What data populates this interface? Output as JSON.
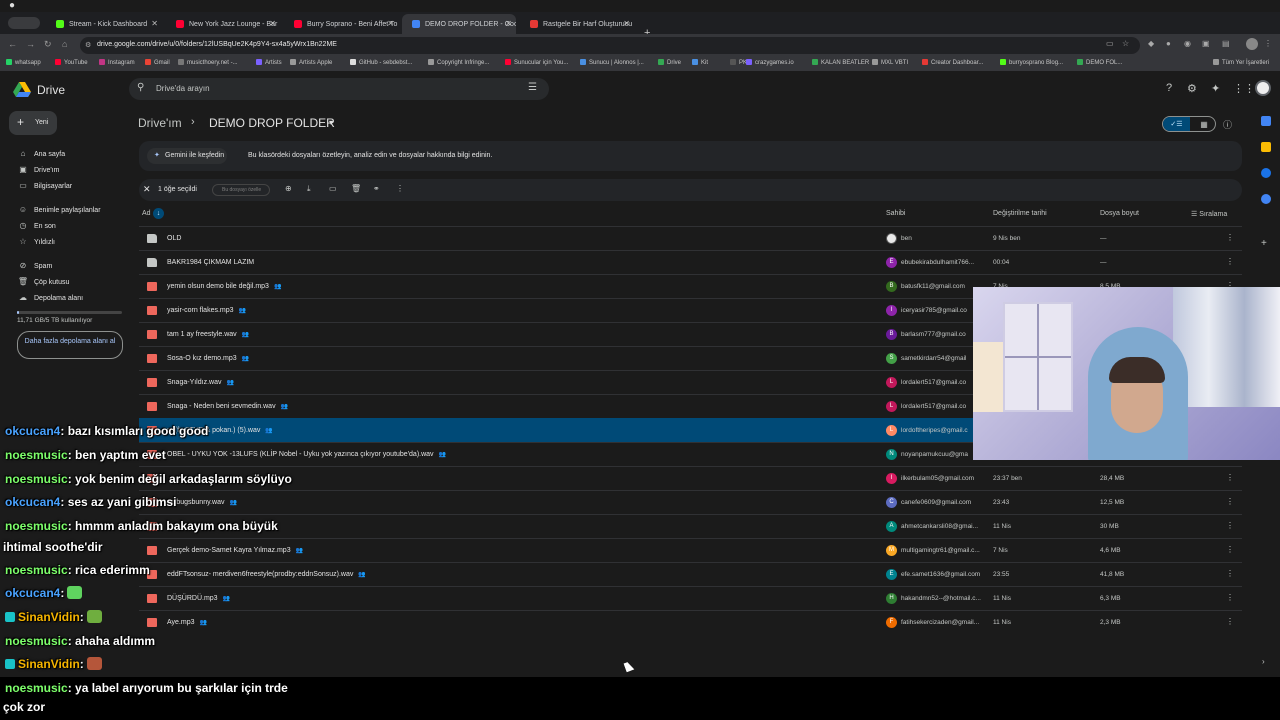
{
  "browser": {
    "tabs": [
      {
        "title": "Stream - Kick Dashboard",
        "color": "#53fc18"
      },
      {
        "title": "New York Jazz Lounge - Bar",
        "color": "#ff0033"
      },
      {
        "title": "Burry Soprano - Beni Affet To",
        "color": "#ff0033"
      },
      {
        "title": "DEMO DROP FOLDER - Goog",
        "color": "#4285f4"
      },
      {
        "title": "Rastgele Bir Harf Oluşturucu",
        "color": "#e53935"
      }
    ],
    "url": "drive.google.com/drive/u/0/folders/12lUSBqUe2K4p9Y4-sx4a5yWrx1Bn22ME",
    "bookmarks": [
      {
        "label": "whatsapp",
        "color": "#25d366"
      },
      {
        "label": "YouTube",
        "color": "#ff0033"
      },
      {
        "label": "Instagram",
        "color": "#c13584"
      },
      {
        "label": "Gmail",
        "color": "#ea4335"
      },
      {
        "label": "musicthoery.net -...",
        "color": "#777777"
      },
      {
        "label": "Artists",
        "color": "#7b61ff"
      },
      {
        "label": "Artists Apple",
        "color": "#999999"
      },
      {
        "label": "GitHub - sebdebst...",
        "color": "#dddddd"
      },
      {
        "label": "Copyright Infringe...",
        "color": "#999999"
      },
      {
        "label": "Sunucular için You...",
        "color": "#ff0033"
      },
      {
        "label": "Sunucu | Alonnos |...",
        "color": "#4a90e2"
      },
      {
        "label": "Drive",
        "color": "#34a853"
      },
      {
        "label": "Kit",
        "color": "#4a90e2"
      },
      {
        "label": "PK",
        "color": "#555555"
      },
      {
        "label": "crazygames.io",
        "color": "#7b61ff"
      },
      {
        "label": "KALAN BEATLER",
        "color": "#34a853"
      },
      {
        "label": "MXL VBTI",
        "color": "#999999"
      },
      {
        "label": "Creator Dashboar...",
        "color": "#e53935"
      },
      {
        "label": "burryosprano Blog...",
        "color": "#53fc18"
      },
      {
        "label": "DEMO FOL...",
        "color": "#34a853"
      },
      {
        "label": "Tüm Yer İşaretleri",
        "color": "#999999"
      }
    ]
  },
  "drive": {
    "app_name": "Drive",
    "search_placeholder": "Drive'da arayın",
    "new_label": "Yeni",
    "nav": [
      {
        "label": "Ana sayfa",
        "icon": "home-icon",
        "glyph": "⌂"
      },
      {
        "label": "Drive'ım",
        "icon": "my-drive-icon",
        "glyph": "▣"
      },
      {
        "label": "Bilgisayarlar",
        "icon": "computer-icon",
        "glyph": "▭"
      },
      {
        "label": "Benimle paylaşılanlar",
        "icon": "shared-icon",
        "glyph": "☺"
      },
      {
        "label": "En son",
        "icon": "clock-icon",
        "glyph": "◷"
      },
      {
        "label": "Yıldızlı",
        "icon": "star-icon",
        "glyph": "☆"
      },
      {
        "label": "Spam",
        "icon": "spam-icon",
        "glyph": "⊘"
      },
      {
        "label": "Çöp kutusu",
        "icon": "trash-icon",
        "glyph": "🗑"
      },
      {
        "label": "Depolama alanı",
        "icon": "cloud-icon",
        "glyph": "☁"
      }
    ],
    "storage_text": "11,71 GB/5 TB kullanılıyor",
    "storage_fraction": 0.0023,
    "more_storage": "Daha fazla depolama alanı al",
    "breadcrumb_root": "Drive'ım",
    "breadcrumb_current": "DEMO DROP FOLDER",
    "gemini_chip": "Gemini ile keşfedin",
    "gemini_text": "Bu klasördeki dosyaları özetleyin, analiz edin ve dosyalar hakkında bilgi edinin.",
    "selection_count": "1 öğe seçildi",
    "selection_share": "Bu dosyayı özelle",
    "columns": {
      "name": "Ad",
      "owner": "Sahibi",
      "modified": "Değiştirilme tarihi",
      "size": "Dosya boyut",
      "sort": "Sıralama"
    },
    "files": [
      {
        "name": "OLD",
        "type": "folder",
        "shared": false,
        "owner": "ben",
        "avatar": "",
        "avatar_color": "#e8e8e8",
        "modified": "9 Nis ben",
        "size": "—"
      },
      {
        "name": "BAKR1984 ÇIKMAM LAZIM",
        "type": "folder",
        "shared": false,
        "owner": "ebubekirabdulhamit766...",
        "avatar": "E",
        "avatar_color": "#8e24aa",
        "modified": "00:04",
        "size": "—"
      },
      {
        "name": "yemin olsun demo bile değil.mp3",
        "type": "audio",
        "shared": true,
        "owner": "batusfk11@gmail.com",
        "avatar": "B",
        "avatar_color": "#33691e",
        "modified": "7 Nis",
        "size": "8,5 MB"
      },
      {
        "name": "yasir-corn flakes.mp3",
        "type": "audio",
        "shared": true,
        "owner": "iceryasir785@gmail.co",
        "avatar": "I",
        "avatar_color": "#8e24aa",
        "modified": "",
        "size": ""
      },
      {
        "name": "tam 1 ay freestyle.wav",
        "type": "audio",
        "shared": true,
        "owner": "barlasm777@gmail.co",
        "avatar": "B",
        "avatar_color": "#6a1b9a",
        "modified": "",
        "size": ""
      },
      {
        "name": "Sosa-O kız demo.mp3",
        "type": "audio",
        "shared": true,
        "owner": "sametkirdarr54@gmail",
        "avatar": "S",
        "avatar_color": "#43a047",
        "modified": "",
        "size": ""
      },
      {
        "name": "Snaga-Yıldız.wav",
        "type": "audio",
        "shared": true,
        "owner": "lordalert517@gmail.co",
        "avatar": "L",
        "avatar_color": "#c2185b",
        "modified": "",
        "size": ""
      },
      {
        "name": "Snaga - Neden beni sevmedin.wav",
        "type": "audio",
        "shared": true,
        "owner": "lordalert517@gmail.co",
        "avatar": "L",
        "avatar_color": "#c2185b",
        "modified": "",
        "size": ""
      },
      {
        "name": "m (ft. STVR & pokan.) (5).wav",
        "type": "audio",
        "shared": true,
        "owner": "lordoftheripes@gmail.c",
        "avatar": "L",
        "avatar_color": "#ff8a65",
        "modified": "",
        "size": "",
        "selected": true
      },
      {
        "name": "OBEL - UYKU YOK -13LUFS (KLİP Nobel - Uyku yok yazınca çıkıyor youtube'da).wav",
        "type": "audio",
        "shared": true,
        "owner": "noyanpamukcuu@gma",
        "avatar": "N",
        "avatar_color": "#00897b",
        "modified": "",
        "size": ""
      },
      {
        "name": "",
        "type": "audio",
        "shared": false,
        "owner": "ilkerbulam05@gmail.com",
        "avatar": "I",
        "avatar_color": "#d81b60",
        "modified": "23:37 ben",
        "size": "28,4 MB"
      },
      {
        "name": "az bugsbunny.wav",
        "type": "audio",
        "shared": true,
        "owner": "canefe0609@gmail.com",
        "avatar": "C",
        "avatar_color": "#5c6bc0",
        "modified": "23:43",
        "size": "12,5 MB"
      },
      {
        "name": "",
        "type": "audio",
        "shared": false,
        "owner": "ahmetcankarsli08@gmai...",
        "avatar": "A",
        "avatar_color": "#00897b",
        "modified": "11 Nis",
        "size": "30 MB"
      },
      {
        "name": "Gerçek demo-Samet Kayra Yılmaz.mp3",
        "type": "audio",
        "shared": true,
        "owner": "multigamingtr61@gmail.c...",
        "avatar": "M",
        "avatar_color": "#f9a825",
        "modified": "7 Nis",
        "size": "4,6 MB"
      },
      {
        "name": "eddFTsonsuz- merdiven6freestyle(prodby:eddnSonsuz).wav",
        "type": "audio",
        "shared": true,
        "owner": "efe.samet1636@gmail.com",
        "avatar": "E",
        "avatar_color": "#00838f",
        "modified": "23:55",
        "size": "41,8 MB"
      },
      {
        "name": "DÜŞÜRDÜ.mp3",
        "type": "audio",
        "shared": true,
        "owner": "hakandmn52--@hotmail.c...",
        "avatar": "H",
        "avatar_color": "#2e7d32",
        "modified": "11 Nis",
        "size": "6,3 MB"
      },
      {
        "name": "Aye.mp3",
        "type": "audio",
        "shared": true,
        "owner": "fatihsekercizaden@gmail...",
        "avatar": "F",
        "avatar_color": "#ef6c00",
        "modified": "11 Nis",
        "size": "2,3 MB"
      }
    ]
  },
  "chat": [
    {
      "user": "okcucan4",
      "user_color": "#4aa3ff",
      "message": ": bazı kısımları good good",
      "badge": "",
      "emote": ""
    },
    {
      "user": "noesmusic",
      "user_color": "#7dff6b",
      "message": ": ben yaptım evet",
      "badge": "",
      "emote": ""
    },
    {
      "user": "noesmusic",
      "user_color": "#7dff6b",
      "message": ": yok benim değil arkadaşlarım söylüyo",
      "badge": "",
      "emote": ""
    },
    {
      "user": "okcucan4",
      "user_color": "#4aa3ff",
      "message": ": ses az yani gibimsi",
      "badge": "",
      "emote": ""
    },
    {
      "user": "noesmusic",
      "user_color": "#7dff6b",
      "message": ": hmmm anladım bakayım ona büyük",
      "badge": "",
      "emote": ""
    },
    {
      "user": "",
      "user_color": "#ffffff",
      "message": "ihtimal soothe'dir",
      "badge": "",
      "emote": ""
    },
    {
      "user": "noesmusic",
      "user_color": "#7dff6b",
      "message": ": rica ederimm",
      "badge": "",
      "emote": ""
    },
    {
      "user": "okcucan4",
      "user_color": "#4aa3ff",
      "message": ":",
      "badge": "",
      "emote": "#5fd35f"
    },
    {
      "user": "SinanVidin",
      "user_color": "#f5b400",
      "message": ":",
      "badge": "#19c3c8",
      "emote": "#6fae3f"
    },
    {
      "user": "noesmusic",
      "user_color": "#7dff6b",
      "message": ": ahaha aldımm",
      "badge": "",
      "emote": ""
    },
    {
      "user": "SinanVidin",
      "user_color": "#f5b400",
      "message": ":",
      "badge": "#19c3c8",
      "emote": "#b5563a"
    },
    {
      "user": "noesmusic",
      "user_color": "#7dff6b",
      "message": ": ya label arıyorum bu şarkılar için trde",
      "badge": "",
      "emote": ""
    },
    {
      "user": "",
      "user_color": "#ffffff",
      "message": "çok zor",
      "badge": "",
      "emote": ""
    }
  ]
}
